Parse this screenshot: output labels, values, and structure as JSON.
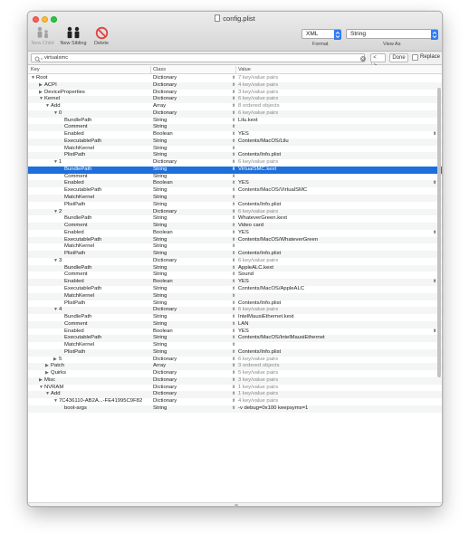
{
  "window": {
    "title": "config.plist"
  },
  "toolbar": {
    "new_child": "New Child",
    "new_sibling": "New Sibling",
    "delete": "Delete",
    "format_value": "XML",
    "format_label": "Format",
    "view_value": "String",
    "view_label": "View As"
  },
  "search": {
    "query": "virtualsmc",
    "done": "Done",
    "replace": "Replace",
    "prev": "<",
    "next": ">"
  },
  "columns": {
    "key": "Key",
    "class": "Class",
    "value": "Value"
  },
  "rows": [
    {
      "key": "Root",
      "class": "Dictionary",
      "value": "7 key/value pairs",
      "level": 0,
      "disc": "open",
      "muted": true
    },
    {
      "key": "ACPI",
      "class": "Dictionary",
      "value": "4 key/value pairs",
      "level": 1,
      "disc": "closed",
      "muted": true
    },
    {
      "key": "DeviceProperties",
      "class": "Dictionary",
      "value": "3 key/value pairs",
      "level": 1,
      "disc": "closed",
      "muted": true
    },
    {
      "key": "Kernel",
      "class": "Dictionary",
      "value": "6 key/value pairs",
      "level": 1,
      "disc": "open",
      "muted": true
    },
    {
      "key": "Add",
      "class": "Array",
      "value": "8 ordered objects",
      "level": 2,
      "disc": "open",
      "muted": true
    },
    {
      "key": "0",
      "class": "Dictionary",
      "value": "6 key/value pairs",
      "level": 3,
      "disc": "open",
      "muted": true
    },
    {
      "key": "BundlePath",
      "class": "String",
      "value": "Lilu.kext",
      "level": 4
    },
    {
      "key": "Comment",
      "class": "String",
      "value": "",
      "level": 4
    },
    {
      "key": "Enabled",
      "class": "Boolean",
      "value": "YES",
      "level": 4,
      "bool": true
    },
    {
      "key": "ExecutablePath",
      "class": "String",
      "value": "Contents/MacOS/Lilu",
      "level": 4
    },
    {
      "key": "MatchKernel",
      "class": "String",
      "value": "",
      "level": 4
    },
    {
      "key": "PlistPath",
      "class": "String",
      "value": "Contents/Info.plist",
      "level": 4
    },
    {
      "key": "1",
      "class": "Dictionary",
      "value": "6 key/value pairs",
      "level": 3,
      "disc": "open",
      "muted": true
    },
    {
      "key": "BundlePath",
      "class": "String",
      "value": "VirtualSMC.kext",
      "level": 4,
      "selected": true
    },
    {
      "key": "Comment",
      "class": "String",
      "value": "",
      "level": 4
    },
    {
      "key": "Enabled",
      "class": "Boolean",
      "value": "YES",
      "level": 4,
      "bool": true
    },
    {
      "key": "ExecutablePath",
      "class": "String",
      "value": "Contents/MacOS/VirtualSMC",
      "level": 4
    },
    {
      "key": "MatchKernel",
      "class": "String",
      "value": "",
      "level": 4
    },
    {
      "key": "PlistPath",
      "class": "String",
      "value": "Contents/Info.plist",
      "level": 4
    },
    {
      "key": "2",
      "class": "Dictionary",
      "value": "6 key/value pairs",
      "level": 3,
      "disc": "open",
      "muted": true
    },
    {
      "key": "BundlePath",
      "class": "String",
      "value": "WhateverGreen.kext",
      "level": 4
    },
    {
      "key": "Comment",
      "class": "String",
      "value": "Video card",
      "level": 4
    },
    {
      "key": "Enabled",
      "class": "Boolean",
      "value": "YES",
      "level": 4,
      "bool": true
    },
    {
      "key": "ExecutablePath",
      "class": "String",
      "value": "Contents/MacOS/WhateverGreen",
      "level": 4
    },
    {
      "key": "MatchKernel",
      "class": "String",
      "value": "",
      "level": 4
    },
    {
      "key": "PlistPath",
      "class": "String",
      "value": "Contents/Info.plist",
      "level": 4
    },
    {
      "key": "3",
      "class": "Dictionary",
      "value": "6 key/value pairs",
      "level": 3,
      "disc": "open",
      "muted": true
    },
    {
      "key": "BundlePath",
      "class": "String",
      "value": "AppleALC.kext",
      "level": 4
    },
    {
      "key": "Comment",
      "class": "String",
      "value": "Sound",
      "level": 4
    },
    {
      "key": "Enabled",
      "class": "Boolean",
      "value": "YES",
      "level": 4,
      "bool": true
    },
    {
      "key": "ExecutablePath",
      "class": "String",
      "value": "Contents/MacOS/AppleALC",
      "level": 4
    },
    {
      "key": "MatchKernel",
      "class": "String",
      "value": "",
      "level": 4
    },
    {
      "key": "PlistPath",
      "class": "String",
      "value": "Contents/Info.plist",
      "level": 4
    },
    {
      "key": "4",
      "class": "Dictionary",
      "value": "6 key/value pairs",
      "level": 3,
      "disc": "open",
      "muted": true
    },
    {
      "key": "BundlePath",
      "class": "String",
      "value": "IntelMausiEthernet.kext",
      "level": 4
    },
    {
      "key": "Comment",
      "class": "String",
      "value": "LAN",
      "level": 4
    },
    {
      "key": "Enabled",
      "class": "Boolean",
      "value": "YES",
      "level": 4,
      "bool": true
    },
    {
      "key": "ExecutablePath",
      "class": "String",
      "value": "Contents/MacOS/IntelMausiEthernet",
      "level": 4
    },
    {
      "key": "MatchKernel",
      "class": "String",
      "value": "",
      "level": 4
    },
    {
      "key": "PlistPath",
      "class": "String",
      "value": "Contents/Info.plist",
      "level": 4
    },
    {
      "key": "5",
      "class": "Dictionary",
      "value": "6 key/value pairs",
      "level": 3,
      "disc": "closed",
      "muted": true
    },
    {
      "key": "Patch",
      "class": "Array",
      "value": "3 ordered objects",
      "level": 2,
      "disc": "closed",
      "muted": true
    },
    {
      "key": "Quirks",
      "class": "Dictionary",
      "value": "5 key/value pairs",
      "level": 2,
      "disc": "closed",
      "muted": true
    },
    {
      "key": "Misc",
      "class": "Dictionary",
      "value": "3 key/value pairs",
      "level": 1,
      "disc": "closed",
      "muted": true
    },
    {
      "key": "NVRAM",
      "class": "Dictionary",
      "value": "1 key/value pairs",
      "level": 1,
      "disc": "open",
      "muted": true
    },
    {
      "key": "Add",
      "class": "Dictionary",
      "value": "1 key/value pairs",
      "level": 2,
      "disc": "open",
      "muted": true
    },
    {
      "key": "7C436110-AB2A...-FE41995C9F82",
      "class": "Dictionary",
      "value": "4 key/value pairs",
      "level": 3,
      "disc": "open",
      "muted": true
    },
    {
      "key": "boot-args",
      "class": "String",
      "value": "-v debug=0x100 keepsyms=1",
      "level": 4
    }
  ],
  "colors": {
    "selection": "#1d6fdc",
    "accent": "#2f7bf5",
    "delete": "#e0443e"
  },
  "icons": {
    "new_child": "person-child-icon",
    "new_sibling": "person-pair-icon",
    "delete": "no-entry-icon",
    "search": "magnifier-icon"
  }
}
